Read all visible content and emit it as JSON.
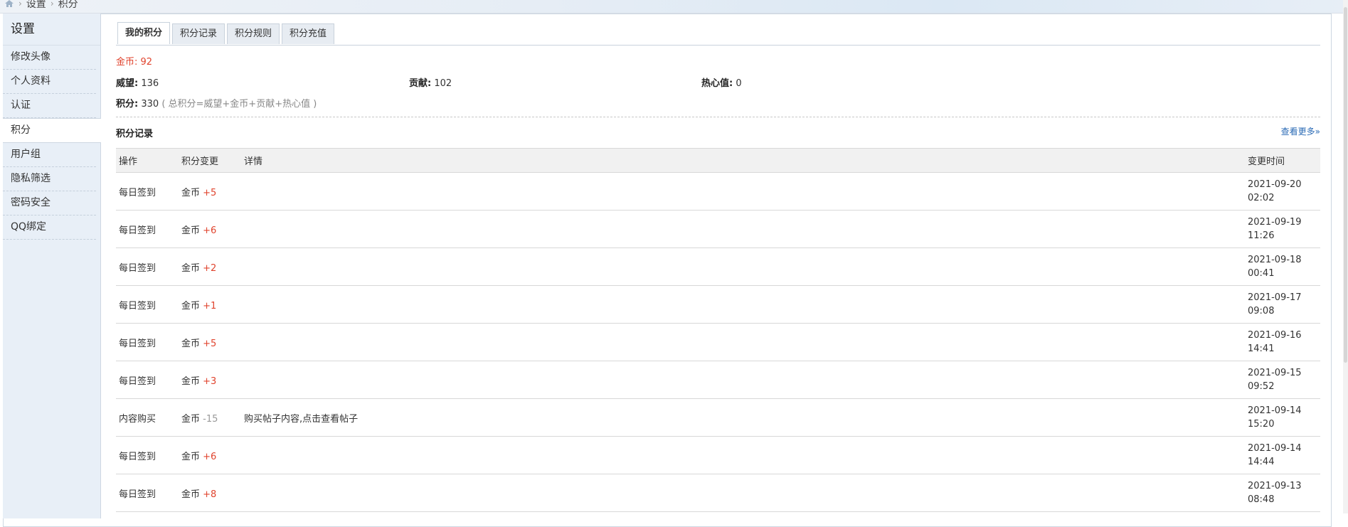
{
  "breadcrumb": {
    "items": [
      "设置",
      "积分"
    ],
    "separator": "›"
  },
  "sidebar": {
    "title": "设置",
    "items": [
      {
        "label": "修改头像"
      },
      {
        "label": "个人资料"
      },
      {
        "label": "认证"
      },
      {
        "label": "积分",
        "active": true
      },
      {
        "label": "用户组"
      },
      {
        "label": "隐私筛选"
      },
      {
        "label": "密码安全"
      },
      {
        "label": "QQ绑定"
      }
    ]
  },
  "tabs": [
    {
      "label": "我的积分",
      "active": true
    },
    {
      "label": "积分记录"
    },
    {
      "label": "积分规则"
    },
    {
      "label": "积分充值"
    }
  ],
  "summary": {
    "gold_label": "金币:",
    "gold_value": "92",
    "prestige_label": "威望:",
    "prestige_value": "136",
    "contrib_label": "贡献:",
    "contrib_value": "102",
    "enthusiasm_label": "热心值:",
    "enthusiasm_value": "0",
    "total_label": "积分:",
    "total_value": "330",
    "total_note": "( 总积分=威望+金币+贡献+热心值 )"
  },
  "records": {
    "title": "积分记录",
    "more_link": "查看更多»",
    "columns": [
      "操作",
      "积分变更",
      "详情",
      "变更时间"
    ],
    "rows": [
      {
        "op": "每日签到",
        "currency": "金币",
        "change": "+5",
        "detail": "",
        "date": "2021-09-20",
        "time": "02:02"
      },
      {
        "op": "每日签到",
        "currency": "金币",
        "change": "+6",
        "detail": "",
        "date": "2021-09-19",
        "time": "11:26"
      },
      {
        "op": "每日签到",
        "currency": "金币",
        "change": "+2",
        "detail": "",
        "date": "2021-09-18",
        "time": "00:41"
      },
      {
        "op": "每日签到",
        "currency": "金币",
        "change": "+1",
        "detail": "",
        "date": "2021-09-17",
        "time": "09:08"
      },
      {
        "op": "每日签到",
        "currency": "金币",
        "change": "+5",
        "detail": "",
        "date": "2021-09-16",
        "time": "14:41"
      },
      {
        "op": "每日签到",
        "currency": "金币",
        "change": "+3",
        "detail": "",
        "date": "2021-09-15",
        "time": "09:52"
      },
      {
        "op": "内容购买",
        "currency": "金币",
        "change": "-15",
        "detail": "购买帖子内容,点击查看帖子",
        "date": "2021-09-14",
        "time": "15:20"
      },
      {
        "op": "每日签到",
        "currency": "金币",
        "change": "+6",
        "detail": "",
        "date": "2021-09-14",
        "time": "14:44"
      },
      {
        "op": "每日签到",
        "currency": "金币",
        "change": "+8",
        "detail": "",
        "date": "2021-09-13",
        "time": "08:48"
      }
    ]
  },
  "colors": {
    "accent_red": "#e0432d",
    "link_blue": "#2a6ab5",
    "sidebar_bg": "#e8eff7"
  }
}
